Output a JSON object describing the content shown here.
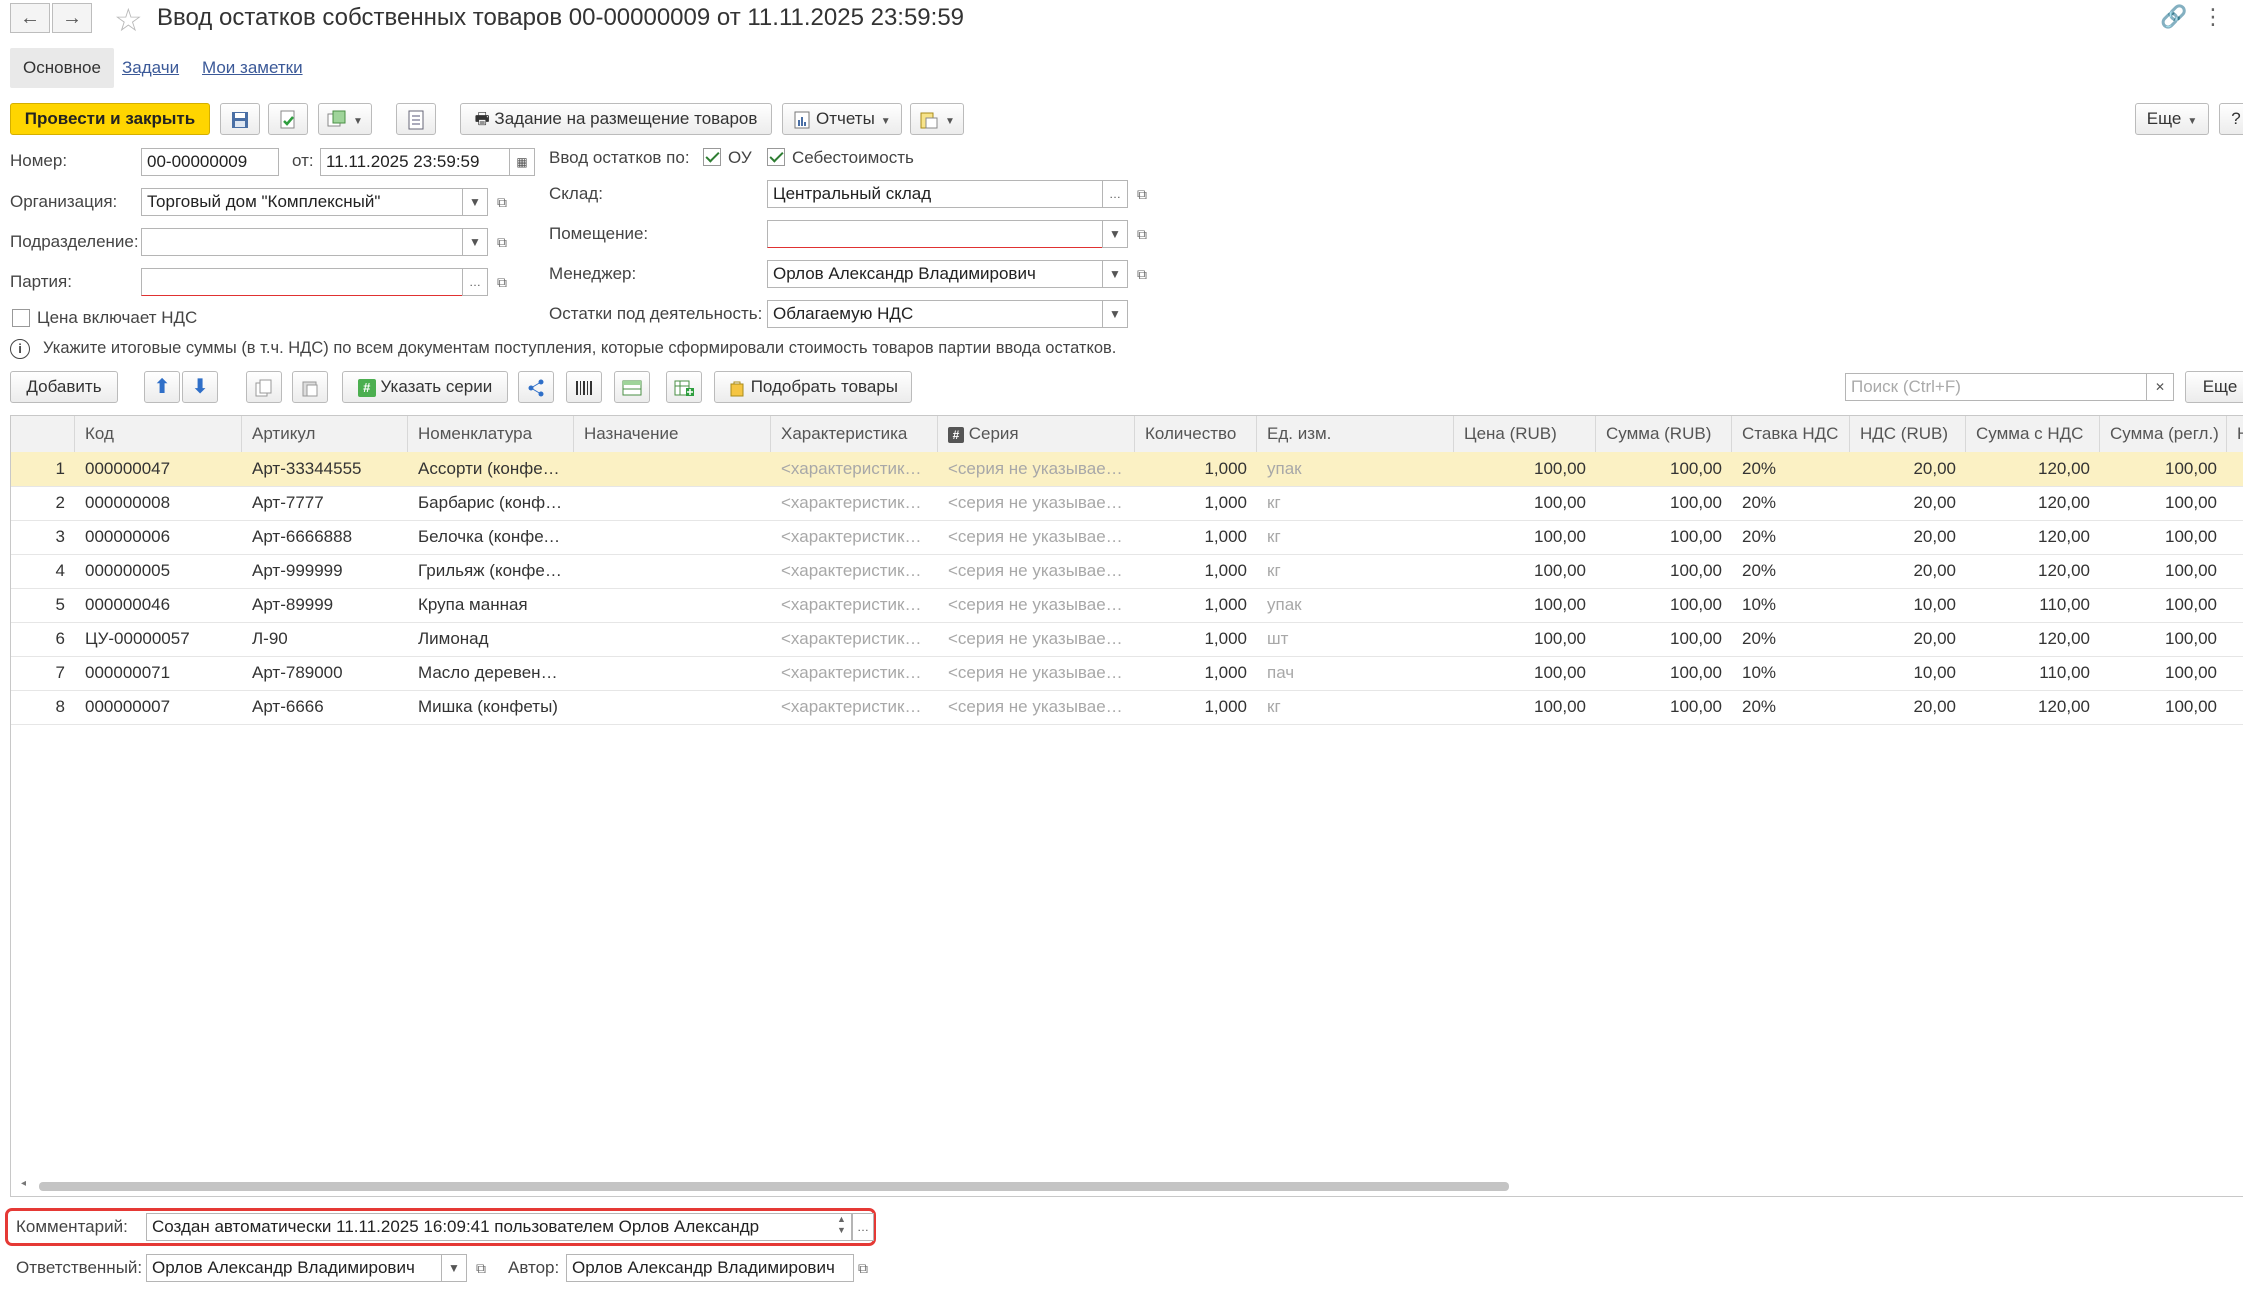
{
  "header": {
    "title": "Ввод остатков собственных товаров 00-00000009 от 11.11.2025 23:59:59"
  },
  "tabs": [
    {
      "label": "Основное"
    },
    {
      "label": "Задачи"
    },
    {
      "label": "Мои заметки"
    }
  ],
  "toolbar": {
    "post_close": "Провести и закрыть",
    "placement_task": "Задание на размещение товаров",
    "reports": "Отчеты",
    "more": "Еще",
    "help": "?"
  },
  "form": {
    "number_label": "Номер:",
    "number_value": "00-00000009",
    "date_label": "от:",
    "date_value": "11.11.2025 23:59:59",
    "org_label": "Организация:",
    "org_value": "Торговый дом \"Комплексный\"",
    "dept_label": "Подразделение:",
    "dept_value": "",
    "batch_label": "Партия:",
    "batch_value": "",
    "price_vat_label": "Цена включает НДС",
    "entry_by_label": "Ввод остатков по:",
    "ou_label": "ОУ",
    "cost_label": "Себестоимость",
    "warehouse_label": "Склад:",
    "warehouse_value": "Центральный склад",
    "room_label": "Помещение:",
    "room_value": "",
    "manager_label": "Менеджер:",
    "manager_value": "Орлов Александр Владимирович",
    "activity_label": "Остатки под деятельность:",
    "activity_value": "Облагаемую НДС",
    "info_text": "Укажите итоговые суммы (в т.ч. НДС) по всем документам поступления, которые сформировали стоимость товаров партии ввода остатков."
  },
  "table_toolbar": {
    "add": "Добавить",
    "specify_series": "Указать серии",
    "pick_goods": "Подобрать товары",
    "search_placeholder": "Поиск (Ctrl+F)",
    "more": "Еще"
  },
  "table": {
    "columns": [
      "Код",
      "Артикул",
      "Номенклатура",
      "Назначение",
      "Характеристика",
      "Серия",
      "Количество",
      "Ед. изм.",
      "Цена (RUB)",
      "Сумма (RUB)",
      "Ставка НДС",
      "НДС (RUB)",
      "Сумма с НДС",
      "Сумма (регл.)",
      "Н"
    ],
    "rows": [
      {
        "n": "1",
        "code": "000000047",
        "art": "Арт-33344555",
        "name": "Ассорти (конфе…",
        "purpose": "",
        "char": "<характеристики…",
        "series": "<серия не указывае…",
        "qty": "1,000",
        "unit": "упак",
        "price": "100,00",
        "sum": "100,00",
        "rate": "20%",
        "vat": "20,00",
        "sum_vat": "120,00",
        "sum_reg": "100,00"
      },
      {
        "n": "2",
        "code": "000000008",
        "art": "Арт-7777",
        "name": "Барбарис (конф…",
        "purpose": "",
        "char": "<характеристики…",
        "series": "<серия не указывае…",
        "qty": "1,000",
        "unit": "кг",
        "price": "100,00",
        "sum": "100,00",
        "rate": "20%",
        "vat": "20,00",
        "sum_vat": "120,00",
        "sum_reg": "100,00"
      },
      {
        "n": "3",
        "code": "000000006",
        "art": "Арт-6666888",
        "name": "Белочка (конфет…",
        "purpose": "",
        "char": "<характеристики…",
        "series": "<серия не указывае…",
        "qty": "1,000",
        "unit": "кг",
        "price": "100,00",
        "sum": "100,00",
        "rate": "20%",
        "vat": "20,00",
        "sum_vat": "120,00",
        "sum_reg": "100,00"
      },
      {
        "n": "4",
        "code": "000000005",
        "art": "Арт-999999",
        "name": "Грильяж (конфе…",
        "purpose": "",
        "char": "<характеристики…",
        "series": "<серия не указывае…",
        "qty": "1,000",
        "unit": "кг",
        "price": "100,00",
        "sum": "100,00",
        "rate": "20%",
        "vat": "20,00",
        "sum_vat": "120,00",
        "sum_reg": "100,00"
      },
      {
        "n": "5",
        "code": "000000046",
        "art": "Арт-89999",
        "name": "Крупа манная",
        "purpose": "",
        "char": "<характеристики…",
        "series": "<серия не указывае…",
        "qty": "1,000",
        "unit": "упак",
        "price": "100,00",
        "sum": "100,00",
        "rate": "10%",
        "vat": "10,00",
        "sum_vat": "110,00",
        "sum_reg": "100,00"
      },
      {
        "n": "6",
        "code": "ЦУ-00000057",
        "art": "Л-90",
        "name": "Лимонад",
        "purpose": "",
        "char": "<характеристики…",
        "series": "<серия не указывае…",
        "qty": "1,000",
        "unit": "шт",
        "price": "100,00",
        "sum": "100,00",
        "rate": "20%",
        "vat": "20,00",
        "sum_vat": "120,00",
        "sum_reg": "100,00"
      },
      {
        "n": "7",
        "code": "000000071",
        "art": "Арт-789000",
        "name": "Масло деревенс…",
        "purpose": "",
        "char": "<характеристики…",
        "series": "<серия не указывае…",
        "qty": "1,000",
        "unit": "пач",
        "price": "100,00",
        "sum": "100,00",
        "rate": "10%",
        "vat": "10,00",
        "sum_vat": "110,00",
        "sum_reg": "100,00"
      },
      {
        "n": "8",
        "code": "000000007",
        "art": "Арт-6666",
        "name": "Мишка (конфеты)",
        "purpose": "",
        "char": "<характеристики…",
        "series": "<серия не указывае…",
        "qty": "1,000",
        "unit": "кг",
        "price": "100,00",
        "sum": "100,00",
        "rate": "20%",
        "vat": "20,00",
        "sum_vat": "120,00",
        "sum_reg": "100,00"
      }
    ]
  },
  "footer": {
    "comment_label": "Комментарий:",
    "comment_value": "Создан автоматически 11.11.2025 16:09:41 пользователем Орлов Александр",
    "responsible_label": "Ответственный:",
    "responsible_value": "Орлов Александр Владимирович",
    "author_label": "Автор:",
    "author_value": "Орлов Александр Владимирович"
  },
  "colors": {
    "primary_button": "#ffd500",
    "selected_row": "#fbf1c4",
    "highlight_frame": "#e53935",
    "link": "#3b5998"
  }
}
